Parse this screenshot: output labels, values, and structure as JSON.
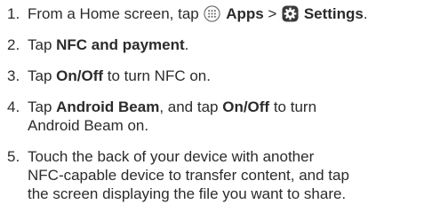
{
  "steps": [
    {
      "num": "1.",
      "parts": {
        "a": "From a Home screen, tap ",
        "apps_icon": "apps-icon",
        "apps": "Apps",
        "sep": " > ",
        "settings_icon": "settings-gear-icon",
        "settings": "Settings",
        "end": "."
      }
    },
    {
      "num": "2.",
      "parts": {
        "a": "Tap ",
        "b": "NFC and payment",
        "c": "."
      }
    },
    {
      "num": "3.",
      "parts": {
        "a": "Tap ",
        "b": "On/Off",
        "c": " to turn NFC on."
      }
    },
    {
      "num": "4.",
      "parts": {
        "a": "Tap ",
        "b": "Android Beam",
        "c": ", and tap ",
        "d": "On/Off",
        "e": " to turn",
        "f": "Android Beam on."
      }
    },
    {
      "num": "5.",
      "lines": [
        "Touch the back of your device with another",
        "NFC-capable device to transfer content, and tap",
        "the screen displaying the file you want to share."
      ]
    }
  ]
}
